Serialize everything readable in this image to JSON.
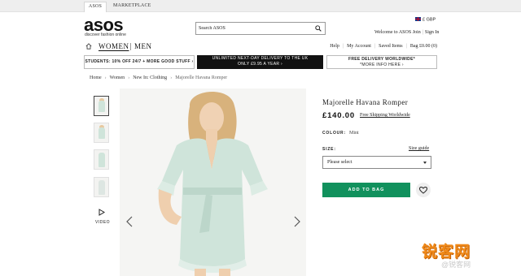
{
  "topbar": {
    "tab_active": "ASOS",
    "tab_marketplace": "MARKETPLACE"
  },
  "header": {
    "logo_text": "asos",
    "logo_tagline": "discover fashion online",
    "search_placeholder": "Search ASOS",
    "currency": "£ GBP",
    "welcome": "Welcome to ASOS",
    "join": "Join",
    "sign_in": "Sign In"
  },
  "nav": {
    "women": "WOMEN",
    "men": "MEN",
    "help": "Help",
    "my_account": "My Account",
    "saved_items": "Saved Items",
    "bag": "Bag £0.00 (0)"
  },
  "promos": {
    "students": "STUDENTS: 10% OFF 24/7 + MORE GOOD STUFF ›",
    "delivery_line1": "UNLIMITED NEXT-DAY DELIVERY TO THE UK",
    "delivery_line2": "ONLY £9.95 A YEAR ›",
    "free_line1": "FREE DELIVERY WORLDWIDE*",
    "free_line2": "*MORE INFO HERE ›"
  },
  "breadcrumb": {
    "home": "Home",
    "women": "Women",
    "new_in": "New In: Clothing",
    "current": "Majorelle Havana Romper"
  },
  "gallery": {
    "video_label": "VIDEO"
  },
  "product": {
    "title": "Majorelle Havana Romper",
    "price": "£140.00",
    "shipping": "Free Shipping Worldwide",
    "colour_label": "COLOUR:",
    "colour_value": "Mint",
    "size_label": "SIZE:",
    "size_guide": "Size guide",
    "size_select": "Please select",
    "add_to_bag": "ADD TO BAG"
  },
  "watermark": {
    "main": "锐客网",
    "sub": "@锐客网"
  },
  "colors": {
    "accent_green": "#11915d",
    "promo_dark": "#111111",
    "dress_mint": "#cfe4da"
  }
}
